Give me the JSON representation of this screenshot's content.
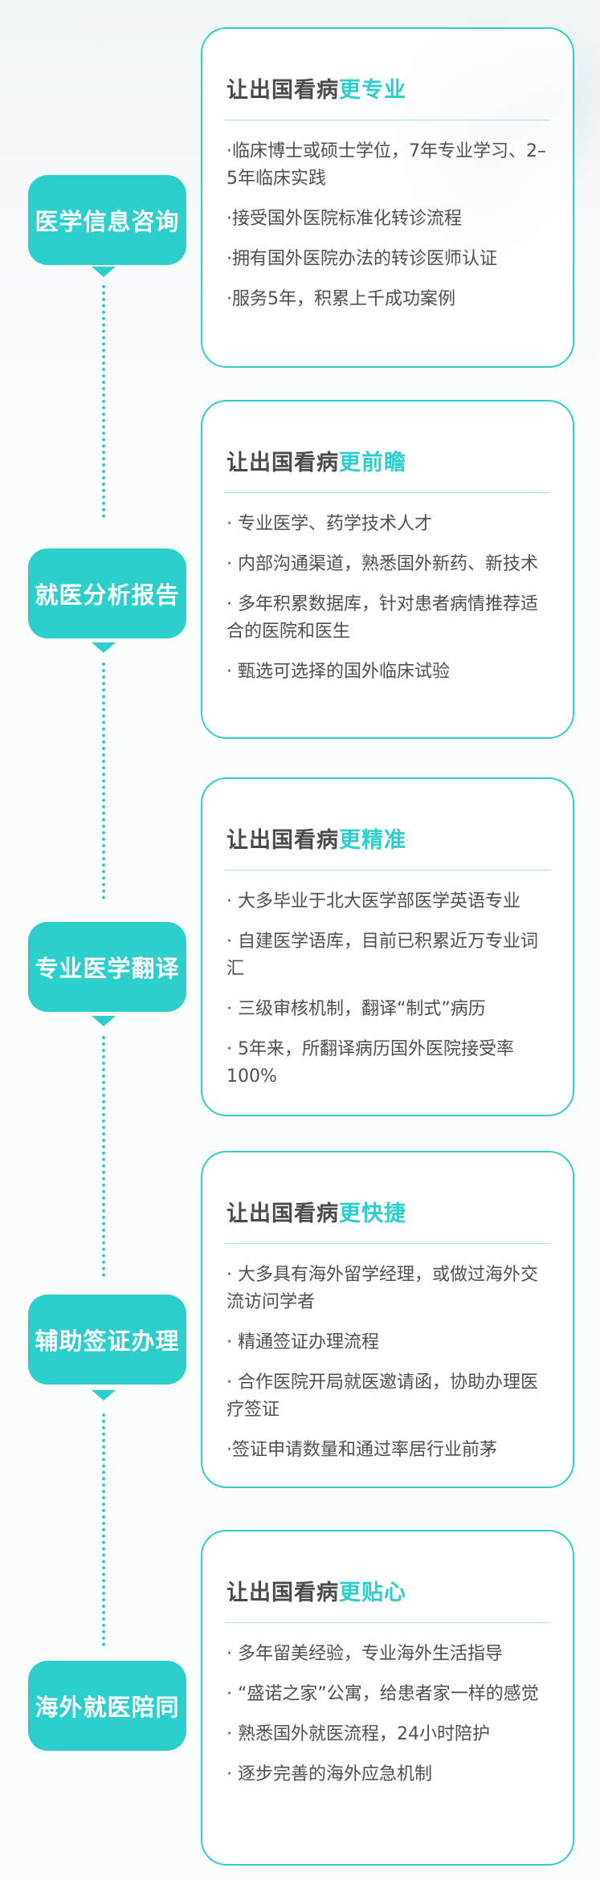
{
  "title_prefix": "让出国看病",
  "sections": [
    {
      "label": "医学信息咨询",
      "highlight": "更专业",
      "items": [
        "·临床博士或硕士学位，7年专业学习、2–5年临床实践",
        "·接受国外医院标准化转诊流程",
        "·拥有国外医院办法的转诊医师认证",
        "·服务5年，积累上千成功案例"
      ]
    },
    {
      "label": "就医分析报告",
      "highlight": "更前瞻",
      "items": [
        "·  专业医学、药学技术人才",
        "·    内部沟通渠道，熟悉国外新药、新技术",
        "·   多年积累数据库，针对患者病情推荐适合的医院和医生",
        "·  甄选可选择的国外临床试验"
      ]
    },
    {
      "label": "专业医学翻译",
      "highlight": "更精准",
      "items": [
        "·  大多毕业于北大医学部医学英语专业",
        "·   自建医学语库，目前已积累近万专业词汇",
        "·  三级审核机制，翻译“制式”病历",
        "·    5年来，所翻译病历国外医院接受率100%"
      ]
    },
    {
      "label": "辅助签证办理",
      "highlight": "更快捷",
      "items": [
        "·   大多具有海外留学经理，或做过海外交流访问学者",
        "·  精通签证办理流程",
        "·   合作医院开局就医邀请函，协助办理医疗签证",
        "·签证申请数量和通过率居行业前茅"
      ]
    },
    {
      "label": "海外就医陪同",
      "highlight": "更贴心",
      "items": [
        "·  多年留美经验，专业海外生活指导",
        "·    “盛诺之家”公寓，给患者家一样的感觉",
        "·  熟悉国外就医流程，24小时陪护",
        "·  逐步完善的海外应急机制"
      ]
    }
  ]
}
